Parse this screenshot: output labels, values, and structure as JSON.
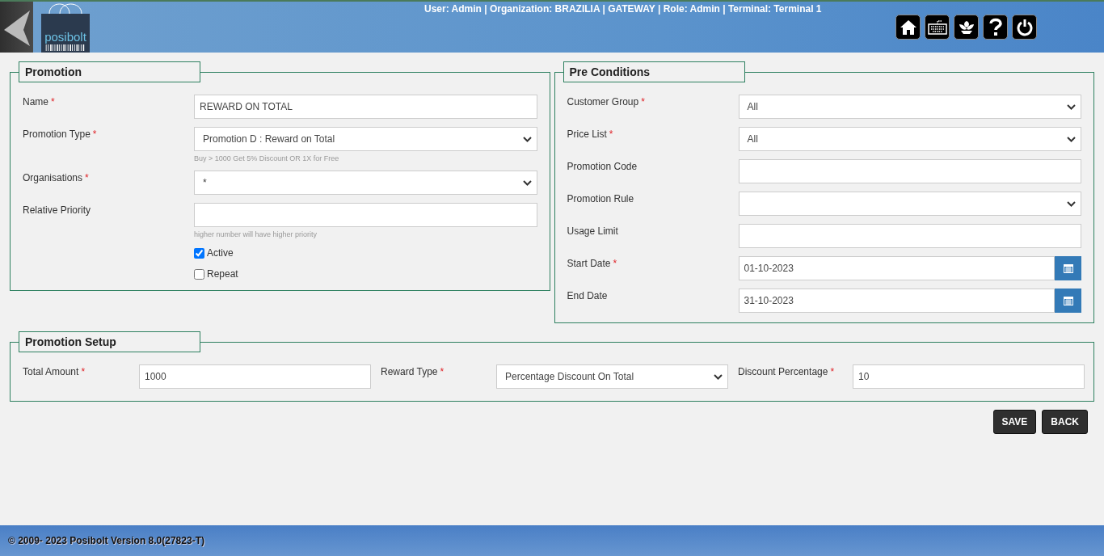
{
  "header": {
    "logo_text": "posibolt",
    "user_info": "User: Admin | Organization: BRAZILIA | GATEWAY | Role: Admin | Terminal: Terminal 1",
    "icons": [
      {
        "kind": "home"
      },
      {
        "kind": "keyboard"
      },
      {
        "kind": "flower"
      },
      {
        "kind": "help"
      },
      {
        "kind": "power"
      }
    ]
  },
  "promotion": {
    "title": "Promotion",
    "fields": [
      {
        "kind": "text",
        "label": "Name",
        "mark": "*",
        "value": "REWARD ON TOTAL"
      },
      {
        "kind": "select",
        "label": "Promotion Type",
        "mark": "*",
        "value": "Promotion D : Reward on Total",
        "hint": "Buy > 1000 Get 5% Discount OR 1X for Free"
      },
      {
        "kind": "select",
        "label": "Organisations",
        "mark": "*",
        "value": "*"
      },
      {
        "kind": "text",
        "label": "Relative Priority",
        "hint": "higher number will have higher priority"
      },
      {
        "kind": "checkbox",
        "label": "Active",
        "checked": true
      },
      {
        "kind": "checkbox",
        "label": "Repeat",
        "checked": false
      }
    ]
  },
  "pre_conditions": {
    "title": "Pre Conditions",
    "fields": [
      {
        "kind": "select",
        "label": "Customer Group",
        "mark": "*",
        "value": "All"
      },
      {
        "kind": "select",
        "label": "Price List",
        "mark": "*",
        "value": "All"
      },
      {
        "kind": "text",
        "label": "Promotion Code"
      },
      {
        "kind": "select",
        "label": "Promotion Rule"
      },
      {
        "kind": "text",
        "label": "Usage Limit"
      },
      {
        "kind": "date",
        "label": "Start Date",
        "mark": "*",
        "value": "01-10-2023"
      },
      {
        "kind": "date",
        "label": "End Date",
        "value": "31-10-2023"
      }
    ]
  },
  "promotion_setup": {
    "title": "Promotion Setup",
    "fields": [
      {
        "kind": "text",
        "label": "Total Amount",
        "mark": "*",
        "value": "1000"
      },
      {
        "kind": "select",
        "label": "Reward Type",
        "mark": "*",
        "value": "Percentage Discount On Total"
      },
      {
        "kind": "text",
        "label": "Discount Percentage",
        "mark": "*",
        "value": "10"
      }
    ]
  },
  "buttons": [
    "SAVE",
    "BACK"
  ],
  "footer": "© 2009- 2023 Posibolt Version  8.0(27823-T)"
}
